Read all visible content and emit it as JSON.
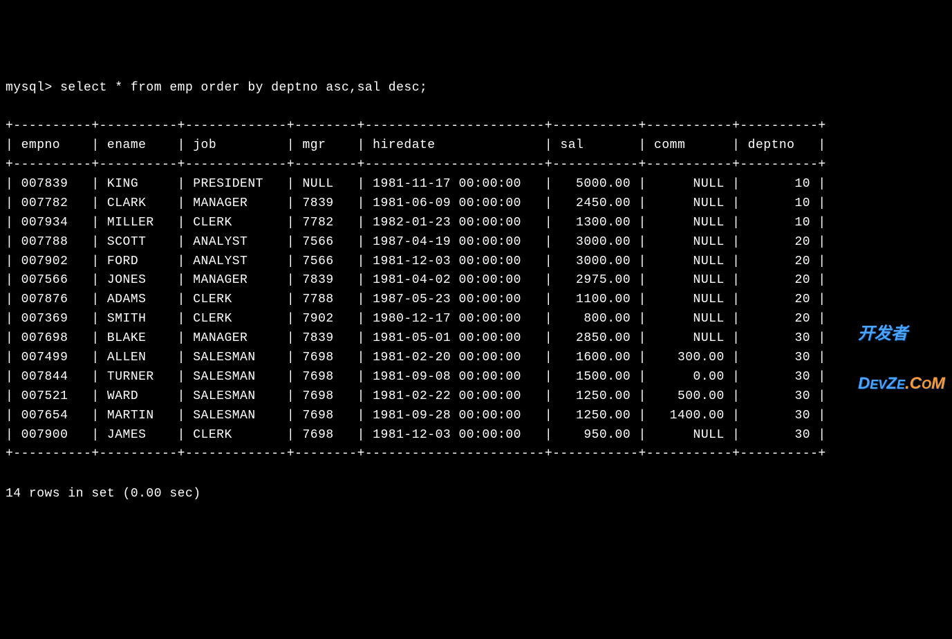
{
  "prompt": "mysql> select * from emp order by deptno asc,sal desc;",
  "columns": [
    "empno",
    "ename",
    "job",
    "mgr",
    "hiredate",
    "sal",
    "comm",
    "deptno"
  ],
  "rows": [
    {
      "empno": "007839",
      "ename": "KING",
      "job": "PRESIDENT",
      "mgr": "NULL",
      "hiredate": "1981-11-17 00:00:00",
      "sal": "5000.00",
      "comm": "NULL",
      "deptno": "10"
    },
    {
      "empno": "007782",
      "ename": "CLARK",
      "job": "MANAGER",
      "mgr": "7839",
      "hiredate": "1981-06-09 00:00:00",
      "sal": "2450.00",
      "comm": "NULL",
      "deptno": "10"
    },
    {
      "empno": "007934",
      "ename": "MILLER",
      "job": "CLERK",
      "mgr": "7782",
      "hiredate": "1982-01-23 00:00:00",
      "sal": "1300.00",
      "comm": "NULL",
      "deptno": "10"
    },
    {
      "empno": "007788",
      "ename": "SCOTT",
      "job": "ANALYST",
      "mgr": "7566",
      "hiredate": "1987-04-19 00:00:00",
      "sal": "3000.00",
      "comm": "NULL",
      "deptno": "20"
    },
    {
      "empno": "007902",
      "ename": "FORD",
      "job": "ANALYST",
      "mgr": "7566",
      "hiredate": "1981-12-03 00:00:00",
      "sal": "3000.00",
      "comm": "NULL",
      "deptno": "20"
    },
    {
      "empno": "007566",
      "ename": "JONES",
      "job": "MANAGER",
      "mgr": "7839",
      "hiredate": "1981-04-02 00:00:00",
      "sal": "2975.00",
      "comm": "NULL",
      "deptno": "20"
    },
    {
      "empno": "007876",
      "ename": "ADAMS",
      "job": "CLERK",
      "mgr": "7788",
      "hiredate": "1987-05-23 00:00:00",
      "sal": "1100.00",
      "comm": "NULL",
      "deptno": "20"
    },
    {
      "empno": "007369",
      "ename": "SMITH",
      "job": "CLERK",
      "mgr": "7902",
      "hiredate": "1980-12-17 00:00:00",
      "sal": "800.00",
      "comm": "NULL",
      "deptno": "20"
    },
    {
      "empno": "007698",
      "ename": "BLAKE",
      "job": "MANAGER",
      "mgr": "7839",
      "hiredate": "1981-05-01 00:00:00",
      "sal": "2850.00",
      "comm": "NULL",
      "deptno": "30"
    },
    {
      "empno": "007499",
      "ename": "ALLEN",
      "job": "SALESMAN",
      "mgr": "7698",
      "hiredate": "1981-02-20 00:00:00",
      "sal": "1600.00",
      "comm": "300.00",
      "deptno": "30"
    },
    {
      "empno": "007844",
      "ename": "TURNER",
      "job": "SALESMAN",
      "mgr": "7698",
      "hiredate": "1981-09-08 00:00:00",
      "sal": "1500.00",
      "comm": "0.00",
      "deptno": "30"
    },
    {
      "empno": "007521",
      "ename": "WARD",
      "job": "SALESMAN",
      "mgr": "7698",
      "hiredate": "1981-02-22 00:00:00",
      "sal": "1250.00",
      "comm": "500.00",
      "deptno": "30"
    },
    {
      "empno": "007654",
      "ename": "MARTIN",
      "job": "SALESMAN",
      "mgr": "7698",
      "hiredate": "1981-09-28 00:00:00",
      "sal": "1250.00",
      "comm": "1400.00",
      "deptno": "30"
    },
    {
      "empno": "007900",
      "ename": "JAMES",
      "job": "CLERK",
      "mgr": "7698",
      "hiredate": "1981-12-03 00:00:00",
      "sal": "950.00",
      "comm": "NULL",
      "deptno": "30"
    }
  ],
  "footer": "14 rows in set (0.00 sec)",
  "colwidths": {
    "empno": 8,
    "ename": 8,
    "job": 11,
    "mgr": 6,
    "hiredate": 21,
    "sal": 9,
    "comm": 9,
    "deptno": 8
  },
  "alignments": {
    "empno": "left",
    "ename": "left",
    "job": "left",
    "mgr": "left",
    "hiredate": "left",
    "sal": "right",
    "comm": "right",
    "deptno": "right"
  },
  "watermark": {
    "line1": "开发者",
    "line2_a": "D",
    "line2_b": "EV",
    "line2_c": "Z",
    "line2_d": "E",
    "line2_e": ".C",
    "line2_f": "O",
    "line2_g": "M"
  }
}
